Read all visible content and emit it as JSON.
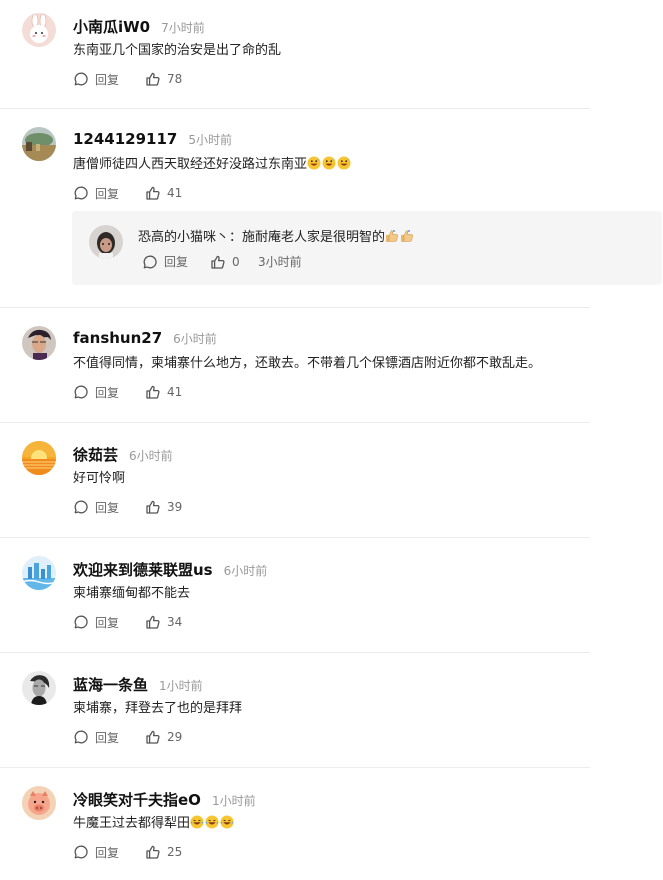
{
  "comments": [
    {
      "username": "小南瓜iW0",
      "time": "7小时前",
      "text": "东南亚几个国家的治安是出了命的乱",
      "emojis": [],
      "reply_label": "回复",
      "likes": "78",
      "avatar": "bunny-avatar"
    },
    {
      "username": "1244129117",
      "time": "5小时前",
      "text": "唐僧师徒四人西天取经还好没路过东南亚",
      "emojis": [
        "grinning-sweat-emoji",
        "grinning-sweat-emoji",
        "grinning-sweat-emoji"
      ],
      "reply_label": "回复",
      "likes": "41",
      "avatar": "landscape-avatar"
    },
    {
      "username": "fanshun27",
      "time": "6小时前",
      "text": "不值得同情，柬埔寨什么地方，还敢去。不带着几个保镖酒店附近你都不敢乱走。",
      "emojis": [],
      "reply_label": "回复",
      "likes": "41",
      "avatar": "portrait-avatar"
    },
    {
      "username": "徐茹芸",
      "time": "6小时前",
      "text": "好可怜啊",
      "emojis": [],
      "reply_label": "回复",
      "likes": "39",
      "avatar": "sunset-avatar"
    },
    {
      "username": "欢迎来到德莱联盟us",
      "time": "6小时前",
      "text": "柬埔寨缅甸都不能去",
      "emojis": [],
      "reply_label": "回复",
      "likes": "34",
      "avatar": "city-avatar"
    },
    {
      "username": "蓝海一条鱼",
      "time": "1小时前",
      "text": "柬埔寨，拜登去了也的是拜拜",
      "emojis": [],
      "reply_label": "回复",
      "likes": "29",
      "avatar": "bw-portrait-avatar"
    },
    {
      "username": "冷眼笑对千夫指eO",
      "time": "1小时前",
      "text": "牛魔王过去都得犁田",
      "emojis": [
        "laughing-tears-emoji",
        "laughing-tears-emoji",
        "laughing-tears-emoji"
      ],
      "reply_label": "回复",
      "likes": "25",
      "avatar": "pig-avatar"
    }
  ],
  "nested_reply": {
    "username": "恐高的小猫咪丶",
    "separator": "：",
    "text": "施耐庵老人家是很明智的",
    "emojis": [
      "thumbs-up-emoji",
      "thumbs-up-emoji"
    ],
    "reply_label": "回复",
    "likes": "0",
    "time": "3小时前"
  },
  "colors": {
    "accent_text": "#111111",
    "meta_text": "#999999",
    "action_text": "#666666",
    "reply_bg": "#f5f5f5",
    "divider": "#ececec"
  }
}
